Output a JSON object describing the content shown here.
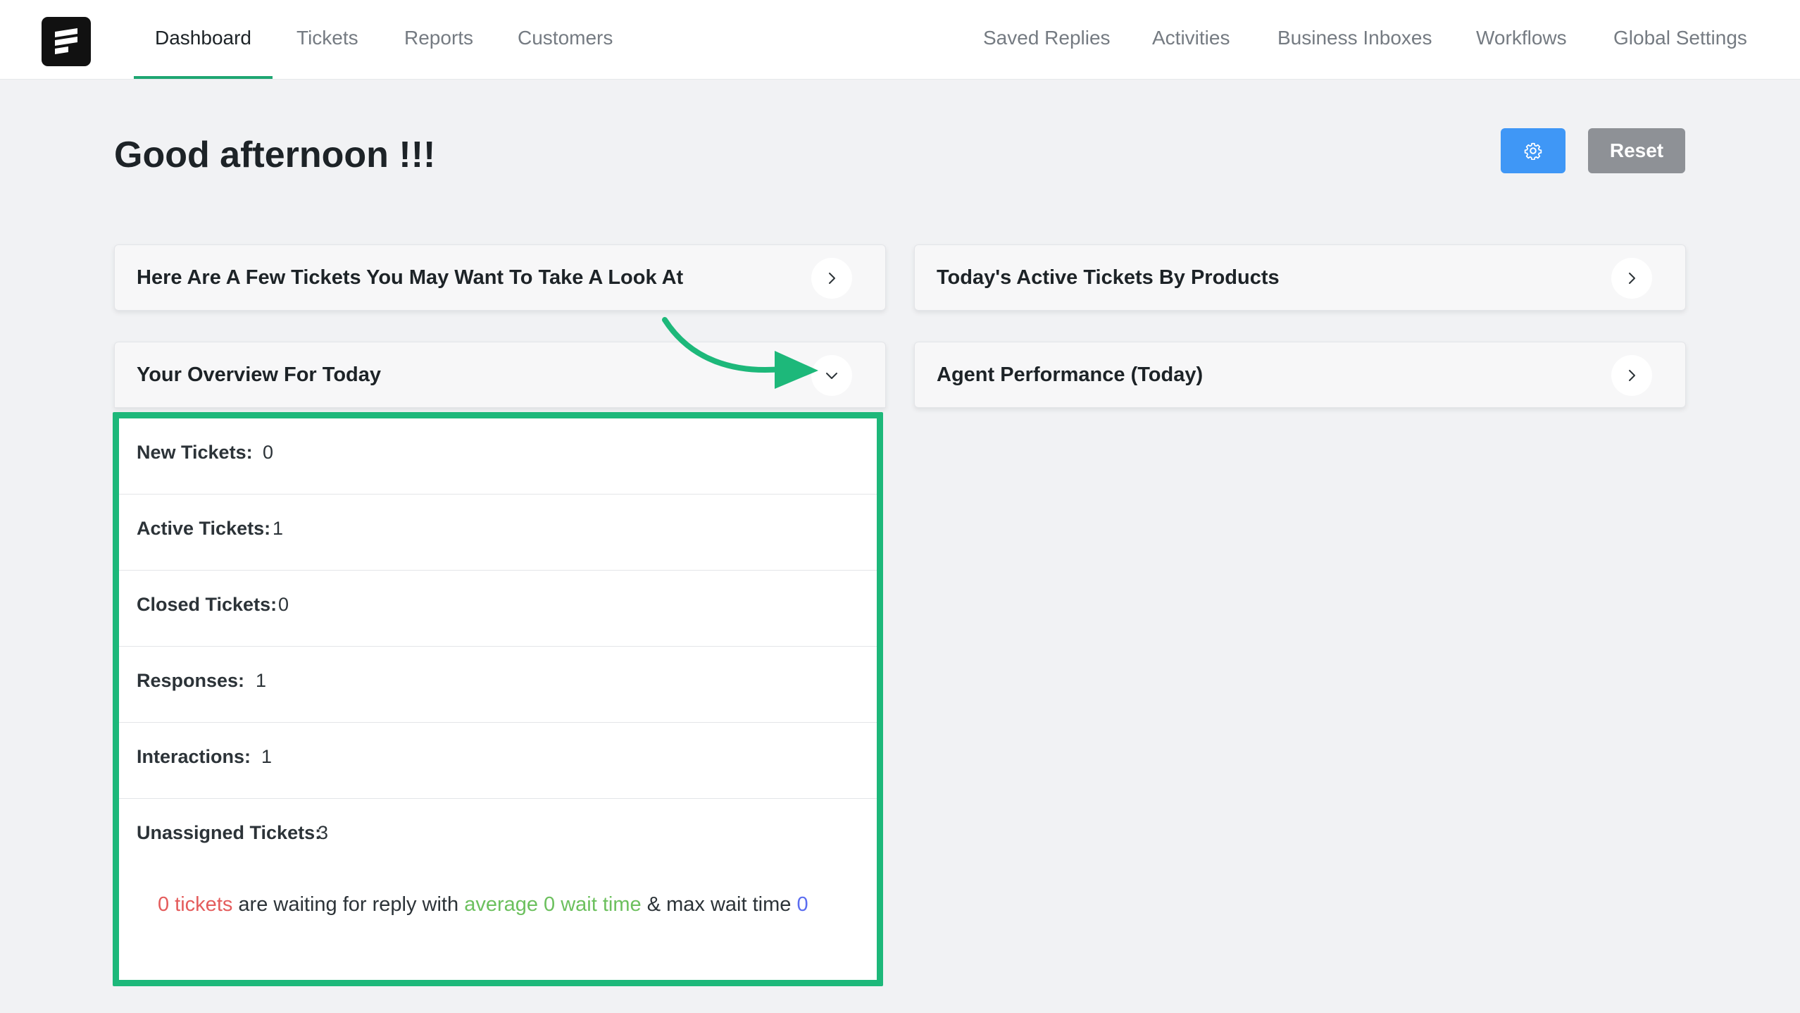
{
  "nav": {
    "left": [
      "Dashboard",
      "Tickets",
      "Reports",
      "Customers"
    ],
    "right": [
      "Saved Replies",
      "Activities",
      "Business Inboxes",
      "Workflows",
      "Global Settings"
    ],
    "active": "Dashboard"
  },
  "header": {
    "greeting": "Good afternoon !!!",
    "reset_label": "Reset"
  },
  "cards": {
    "look_at": "Here Are A Few Tickets You May Want To Take A Look At",
    "by_products": "Today's Active Tickets By Products",
    "overview": "Your Overview For Today",
    "agent_performance": "Agent Performance (Today)"
  },
  "overview": {
    "stats": [
      {
        "label": "New Tickets:",
        "value": "0"
      },
      {
        "label": "Active Tickets:",
        "value": "1"
      },
      {
        "label": "Closed Tickets:",
        "value": "0"
      },
      {
        "label": "Responses:",
        "value": "1"
      },
      {
        "label": "Interactions:",
        "value": "1"
      },
      {
        "label": "Unassigned Tickets:",
        "value": "3"
      }
    ],
    "summary": {
      "tickets": "0 tickets",
      "waiting": " are waiting for reply with ",
      "average": "average 0 wait time",
      "max": " & max wait time ",
      "max_value": "0"
    }
  },
  "colors": {
    "accent": "#1ea672",
    "highlight_border": "#1db87a",
    "primary_button": "#3f97f6",
    "reset_button": "#8e9196"
  }
}
